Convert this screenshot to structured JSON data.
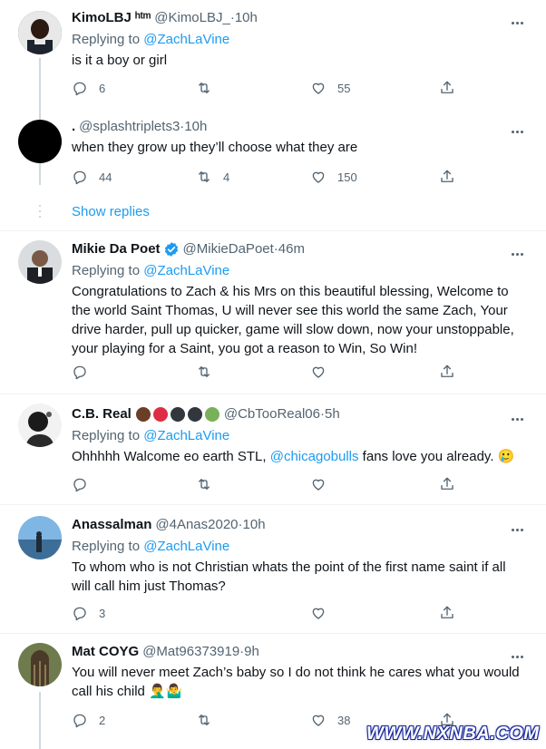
{
  "colors": {
    "accent": "#1d9bf0",
    "muted": "#536471",
    "text": "#0f1419"
  },
  "tweets": [
    {
      "name": "KimoLBJ ʰᵗᵐ",
      "handle": "@KimoLBJ_",
      "time": "10h",
      "replying_prefix": "Replying to ",
      "replying_to": "@ZachLaVine",
      "text": "is it a boy or girl",
      "replies": "6",
      "retweets": "",
      "likes": "55"
    },
    {
      "name": ".",
      "handle": "@splashtriplets3",
      "time": "10h",
      "text": "when they grow up they’ll choose what they are",
      "replies": "44",
      "retweets": "4",
      "likes": "150"
    },
    {
      "name": "Mikie Da Poet",
      "handle": "@MikieDaPoet",
      "time": "46m",
      "replying_prefix": "Replying to ",
      "replying_to": "@ZachLaVine",
      "text_lines": [
        "Congratulations to Zach & his Mrs on this beautiful blessing, Welcome to",
        "the world Saint Thomas, U will never see this world the same Zach, Your",
        "drive harder, pull up quicker, game will slow down, now your unstoppable,",
        "your playing for a Saint, you got a reason to Win, So Win!"
      ]
    },
    {
      "name": "C.B. Real",
      "handle": "@CbTooReal06",
      "time": "5h",
      "replying_prefix": "Replying to ",
      "replying_to": "@ZachLaVine",
      "text_before": "Ohhhhh Walcome eo earth STL, ",
      "text_mention": "@chicagobulls",
      "text_after": " fans love you already. 🥲"
    },
    {
      "name": "Anassalman",
      "handle": "@4Anas2020",
      "time": "10h",
      "replying_prefix": "Replying to ",
      "replying_to": "@ZachLaVine",
      "text_lines": [
        "To whom who is not Christian whats the point of the first name saint if all",
        "will call him just Thomas?"
      ],
      "replies": "3"
    },
    {
      "name": "Mat COYG",
      "handle": "@Mat96373919",
      "time": "9h",
      "text_lines": [
        "You will never meet Zach’s baby so I do not think he cares what you would",
        "call his child 🤦‍♂️🤷‍♂️"
      ],
      "replies": "2",
      "likes": "38"
    }
  ],
  "show_replies": "Show replies",
  "separator_dot": " · ",
  "watermark": "WWW.NXNBA.COM"
}
